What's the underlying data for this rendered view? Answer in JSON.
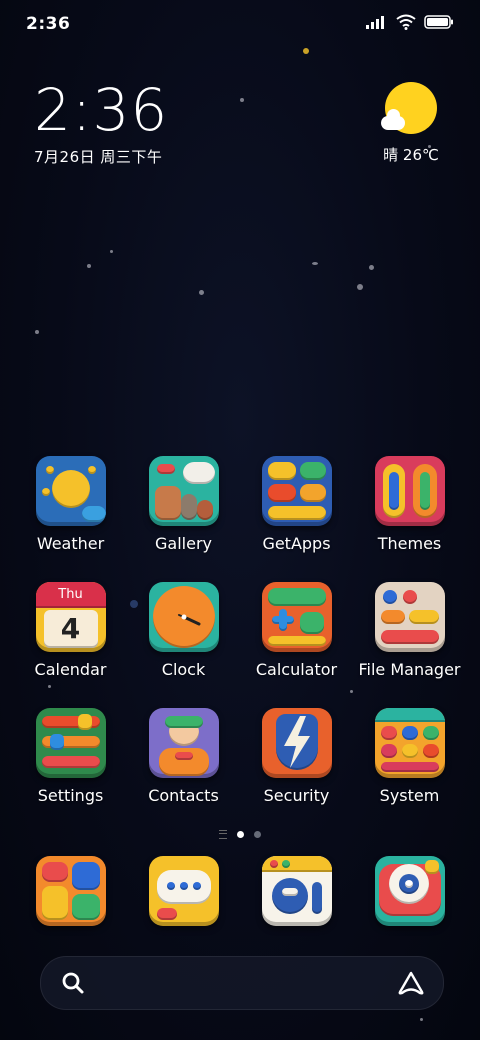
{
  "status_bar": {
    "time": "2:36",
    "icons": [
      "signal-icon",
      "wifi-icon",
      "battery-icon"
    ]
  },
  "clock_widget": {
    "time": "2:36",
    "date": "7月26日 周三下午"
  },
  "weather_widget": {
    "icon": "sunny-cloud-icon",
    "text": "晴 26℃"
  },
  "apps": [
    [
      {
        "label": "Weather",
        "icon": "weather-icon"
      },
      {
        "label": "Gallery",
        "icon": "gallery-icon"
      },
      {
        "label": "GetApps",
        "icon": "getapps-icon"
      },
      {
        "label": "Themes",
        "icon": "themes-icon"
      }
    ],
    [
      {
        "label": "Calendar",
        "icon": "calendar-icon",
        "day_name": "Thu",
        "day_num": "4"
      },
      {
        "label": "Clock",
        "icon": "clock-icon"
      },
      {
        "label": "Calculator",
        "icon": "calculator-icon"
      },
      {
        "label": "File Manager",
        "icon": "file-manager-icon"
      }
    ],
    [
      {
        "label": "Settings",
        "icon": "settings-icon"
      },
      {
        "label": "Contacts",
        "icon": "contacts-icon"
      },
      {
        "label": "Security",
        "icon": "security-icon"
      },
      {
        "label": "System",
        "icon": "system-icon"
      }
    ]
  ],
  "page_indicator": {
    "pages": 2,
    "current": 1
  },
  "dock": [
    {
      "icon": "phone-launcher-icon"
    },
    {
      "icon": "messages-icon"
    },
    {
      "icon": "browser-icon"
    },
    {
      "icon": "camera-icon"
    }
  ],
  "search_bar": {
    "search_icon": "search-icon",
    "assistant_icon": "assistant-icon"
  },
  "colors": {
    "background": "#070a18",
    "sun": "#ffd21f"
  }
}
